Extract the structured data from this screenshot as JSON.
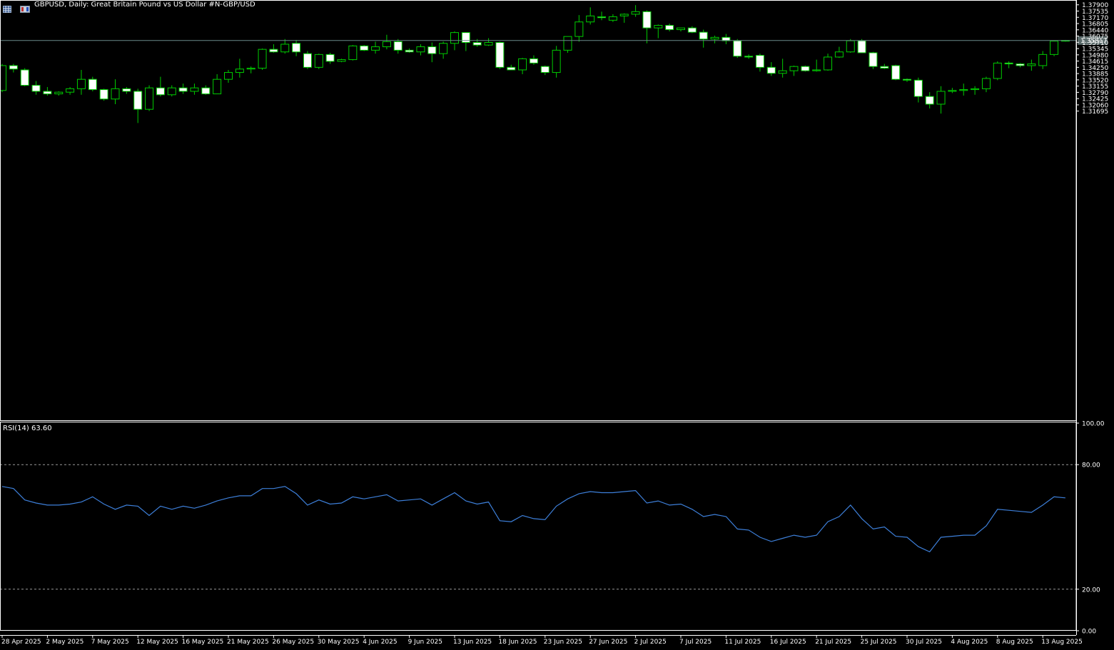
{
  "header": {
    "symbol_line": "GBPUSD, Daily:  Great Britain Pound vs US Dollar #N-GBP/USD",
    "rsi_label": "RSI(14) 63.60"
  },
  "toolbar": {
    "icons": [
      "chart-grid-icon",
      "one-click-trading-icon"
    ]
  },
  "colors": {
    "background": "#000000",
    "bull_fill": "#000000",
    "bear_fill": "#ffffff",
    "wick": "#00cc00",
    "rsi_line": "#3d7fd9",
    "price_line": "#6a8a8a",
    "axis": "#ffffff",
    "levels": "#9a9a9a"
  },
  "chart_data": [
    {
      "type": "candlestick",
      "title": "GBPUSD, Daily:  Great Britain Pound vs US Dollar #N-GBP/USD",
      "ylim": [
        1.1365,
        1.3818
      ],
      "y_ticks": [
        "1.37900",
        "1.37535",
        "1.37170",
        "1.36805",
        "1.36440",
        "1.36075",
        "1.35710",
        "1.35345",
        "1.34980",
        "1.34615",
        "1.34250",
        "1.33885",
        "1.33520",
        "1.33155",
        "1.32790",
        "1.32425",
        "1.32060",
        "1.31695"
      ],
      "current_price": "1.35817",
      "x_ticks": [
        "28 Apr 2025",
        "2 May 2025",
        "7 May 2025",
        "12 May 2025",
        "16 May 2025",
        "21 May 2025",
        "26 May 2025",
        "30 May 2025",
        "4 Jun 2025",
        "9 Jun 2025",
        "13 Jun 2025",
        "18 Jun 2025",
        "23 Jun 2025",
        "27 Jun 2025",
        "2 Jul 2025",
        "7 Jul 2025",
        "11 Jul 2025",
        "16 Jul 2025",
        "21 Jul 2025",
        "25 Jul 2025",
        "30 Jul 2025",
        "4 Aug 2025",
        "8 Aug 2025",
        "13 Aug 2025"
      ],
      "ohlc": [
        [
          1.329,
          1.3445,
          1.328,
          1.3435
        ],
        [
          1.3435,
          1.3445,
          1.3395,
          1.3415
        ],
        [
          1.341,
          1.342,
          1.3315,
          1.332
        ],
        [
          1.332,
          1.3345,
          1.3265,
          1.3285
        ],
        [
          1.3285,
          1.331,
          1.326,
          1.327
        ],
        [
          1.327,
          1.3285,
          1.326,
          1.328
        ],
        [
          1.328,
          1.331,
          1.3265,
          1.33
        ],
        [
          1.33,
          1.341,
          1.3265,
          1.3355
        ],
        [
          1.3355,
          1.337,
          1.3285,
          1.3295
        ],
        [
          1.3295,
          1.33,
          1.323,
          1.324
        ],
        [
          1.324,
          1.3355,
          1.321,
          1.33
        ],
        [
          1.33,
          1.331,
          1.327,
          1.3285
        ],
        [
          1.3285,
          1.33,
          1.31,
          1.318
        ],
        [
          1.318,
          1.332,
          1.317,
          1.3305
        ],
        [
          1.3305,
          1.337,
          1.3255,
          1.3265
        ],
        [
          1.3265,
          1.332,
          1.3255,
          1.3305
        ],
        [
          1.3305,
          1.333,
          1.327,
          1.3285
        ],
        [
          1.3285,
          1.333,
          1.3265,
          1.3305
        ],
        [
          1.3305,
          1.332,
          1.3265,
          1.327
        ],
        [
          1.327,
          1.3385,
          1.327,
          1.3355
        ],
        [
          1.3355,
          1.341,
          1.3335,
          1.3395
        ],
        [
          1.3395,
          1.3475,
          1.3365,
          1.3415
        ],
        [
          1.3415,
          1.343,
          1.339,
          1.342
        ],
        [
          1.342,
          1.3535,
          1.341,
          1.353
        ],
        [
          1.353,
          1.356,
          1.351,
          1.3515
        ],
        [
          1.3515,
          1.359,
          1.3505,
          1.356
        ],
        [
          1.3565,
          1.3585,
          1.349,
          1.3515
        ],
        [
          1.3505,
          1.352,
          1.3415,
          1.3425
        ],
        [
          1.3425,
          1.3505,
          1.3415,
          1.35
        ],
        [
          1.35,
          1.351,
          1.3445,
          1.346
        ],
        [
          1.346,
          1.3475,
          1.3455,
          1.347
        ],
        [
          1.347,
          1.3555,
          1.3465,
          1.355
        ],
        [
          1.355,
          1.3555,
          1.352,
          1.3525
        ],
        [
          1.3525,
          1.3575,
          1.3505,
          1.3545
        ],
        [
          1.3545,
          1.3615,
          1.353,
          1.3575
        ],
        [
          1.3575,
          1.359,
          1.3505,
          1.3525
        ],
        [
          1.3525,
          1.3535,
          1.351,
          1.3515
        ],
        [
          1.3515,
          1.356,
          1.3495,
          1.3545
        ],
        [
          1.3545,
          1.357,
          1.3455,
          1.3505
        ],
        [
          1.3505,
          1.3575,
          1.3475,
          1.3565
        ],
        [
          1.3565,
          1.3635,
          1.3525,
          1.3628
        ],
        [
          1.3628,
          1.363,
          1.352,
          1.357
        ],
        [
          1.357,
          1.359,
          1.3545,
          1.3555
        ],
        [
          1.3555,
          1.3595,
          1.355,
          1.357
        ],
        [
          1.357,
          1.3575,
          1.3415,
          1.3425
        ],
        [
          1.3425,
          1.344,
          1.341,
          1.341
        ],
        [
          1.341,
          1.348,
          1.3385,
          1.3475
        ],
        [
          1.3475,
          1.3495,
          1.344,
          1.345
        ],
        [
          1.343,
          1.3435,
          1.338,
          1.3395
        ],
        [
          1.3395,
          1.355,
          1.3365,
          1.3525
        ],
        [
          1.3525,
          1.36,
          1.351,
          1.3605
        ],
        [
          1.3605,
          1.373,
          1.3575,
          1.369
        ],
        [
          1.369,
          1.3775,
          1.3675,
          1.3725
        ],
        [
          1.372,
          1.375,
          1.37,
          1.3715
        ],
        [
          1.37,
          1.3735,
          1.369,
          1.372
        ],
        [
          1.3725,
          1.374,
          1.3685,
          1.3735
        ],
        [
          1.3735,
          1.3788,
          1.372,
          1.375
        ],
        [
          1.375,
          1.3757,
          1.3565,
          1.3655
        ],
        [
          1.3655,
          1.3675,
          1.3595,
          1.367
        ],
        [
          1.367,
          1.368,
          1.3635,
          1.3645
        ],
        [
          1.3645,
          1.3655,
          1.3635,
          1.3655
        ],
        [
          1.3655,
          1.3665,
          1.3625,
          1.363
        ],
        [
          1.363,
          1.3645,
          1.354,
          1.359
        ],
        [
          1.359,
          1.361,
          1.3565,
          1.36
        ],
        [
          1.36,
          1.362,
          1.356,
          1.358
        ],
        [
          1.358,
          1.359,
          1.348,
          1.349
        ],
        [
          1.349,
          1.35,
          1.3475,
          1.3485
        ],
        [
          1.3495,
          1.3505,
          1.34,
          1.3425
        ],
        [
          1.3425,
          1.3455,
          1.3375,
          1.339
        ],
        [
          1.339,
          1.3475,
          1.3365,
          1.3405
        ],
        [
          1.3405,
          1.3435,
          1.3375,
          1.343
        ],
        [
          1.343,
          1.3435,
          1.34,
          1.3405
        ],
        [
          1.3405,
          1.347,
          1.34,
          1.341
        ],
        [
          1.341,
          1.3505,
          1.3405,
          1.3485
        ],
        [
          1.3485,
          1.3545,
          1.348,
          1.3515
        ],
        [
          1.3515,
          1.359,
          1.351,
          1.358
        ],
        [
          1.358,
          1.359,
          1.351,
          1.351
        ],
        [
          1.351,
          1.3515,
          1.3415,
          1.343
        ],
        [
          1.343,
          1.3445,
          1.3415,
          1.342
        ],
        [
          1.3435,
          1.344,
          1.335,
          1.3355
        ],
        [
          1.3355,
          1.336,
          1.334,
          1.335
        ],
        [
          1.335,
          1.3365,
          1.322,
          1.3255
        ],
        [
          1.3255,
          1.328,
          1.3185,
          1.321
        ],
        [
          1.321,
          1.3315,
          1.3155,
          1.3285
        ],
        [
          1.3285,
          1.3305,
          1.3275,
          1.329
        ],
        [
          1.329,
          1.333,
          1.326,
          1.3295
        ],
        [
          1.3295,
          1.3315,
          1.3265,
          1.33
        ],
        [
          1.33,
          1.337,
          1.328,
          1.336
        ],
        [
          1.336,
          1.346,
          1.335,
          1.345
        ],
        [
          1.345,
          1.346,
          1.342,
          1.3445
        ],
        [
          1.3445,
          1.345,
          1.3425,
          1.3435
        ],
        [
          1.3435,
          1.347,
          1.3405,
          1.3445
        ],
        [
          1.3435,
          1.352,
          1.3415,
          1.35
        ],
        [
          1.35,
          1.358,
          1.349,
          1.3578
        ],
        [
          1.3578,
          1.3585,
          1.3575,
          1.3582
        ]
      ]
    },
    {
      "type": "line",
      "title": "RSI(14) 63.60",
      "ylim": [
        0,
        100
      ],
      "y_ticks": [
        "100.00",
        "80.00",
        "20.00",
        "0.00"
      ],
      "levels": [
        80,
        20
      ],
      "series": [
        {
          "name": "RSI(14)",
          "values": [
            69.5,
            68.5,
            63.0,
            61.5,
            60.5,
            60.5,
            61.0,
            62.0,
            64.5,
            61.0,
            58.5,
            60.5,
            60.0,
            55.5,
            60.0,
            58.5,
            60.0,
            59.0,
            60.5,
            62.5,
            64.0,
            65.0,
            65.0,
            68.5,
            68.5,
            69.5,
            66.0,
            60.5,
            63.0,
            61.0,
            61.5,
            64.5,
            63.5,
            64.5,
            65.5,
            62.5,
            63.0,
            63.5,
            60.5,
            63.5,
            66.5,
            62.5,
            61.0,
            62.0,
            53.0,
            52.5,
            55.5,
            54.0,
            53.5,
            60.0,
            63.5,
            66.0,
            67.0,
            66.5,
            66.5,
            67.0,
            67.5,
            61.5,
            62.5,
            60.5,
            61.0,
            58.5,
            55.0,
            56.0,
            55.0,
            49.0,
            48.5,
            45.0,
            43.0,
            44.5,
            46.0,
            45.0,
            46.0,
            52.5,
            55.0,
            60.5,
            54.0,
            49.0,
            50.0,
            45.5,
            45.0,
            40.5,
            38.0,
            45.0,
            45.5,
            46.0,
            46.0,
            50.5,
            58.5,
            58.0,
            57.5,
            57.0,
            60.5,
            64.5,
            64.0
          ]
        }
      ]
    }
  ]
}
